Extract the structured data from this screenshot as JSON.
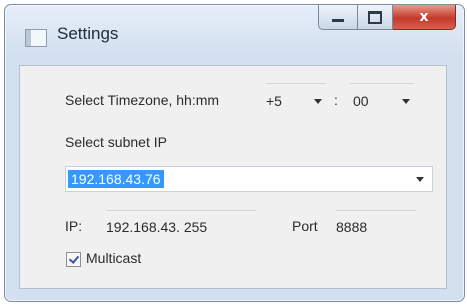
{
  "window": {
    "title": "Settings",
    "close_glyph": "x"
  },
  "timezone": {
    "label": "Select Timezone, hh:mm",
    "hours_value": "+5",
    "separator": ":",
    "minutes_value": "00"
  },
  "subnet": {
    "label": "Select subnet IP",
    "selected_value": "192.168.43.76"
  },
  "ip": {
    "label": "IP:",
    "value": "192.168.43. 255"
  },
  "port": {
    "label": "Port",
    "value": "8888"
  },
  "multicast": {
    "label": "Multicast",
    "checked": true
  },
  "icons": [
    "window-icon",
    "minimize-icon",
    "maximize-icon",
    "close-icon",
    "chevron-down-icon",
    "checkmark-icon"
  ]
}
